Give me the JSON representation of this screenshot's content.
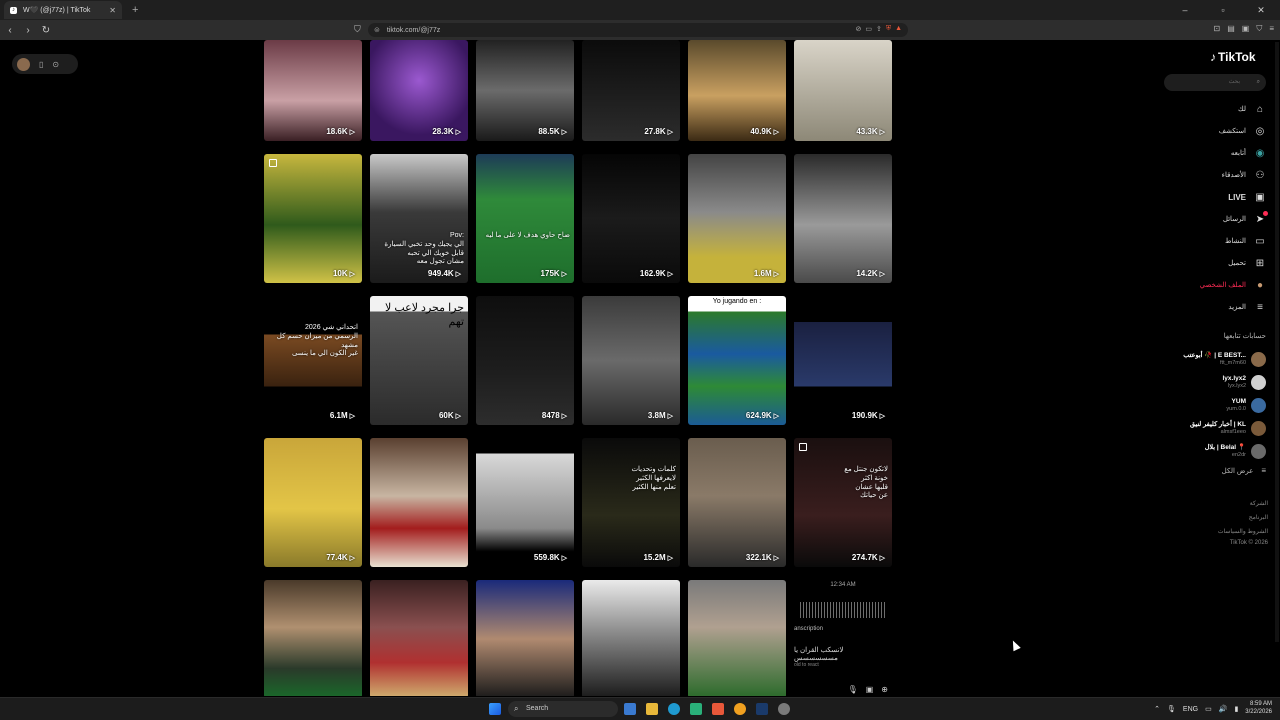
{
  "browser": {
    "tab_title": "W🖤 (@j77z) | TikTok",
    "new_tab": "+",
    "url": "tiktok.com/@j77z",
    "win_min": "–",
    "win_max": "▫",
    "win_close": "✕"
  },
  "grid": {
    "rows": [
      [
        {
          "views": "18.6K",
          "bg": "linear-gradient(180deg,#6b3b46,#c9a0a5 60%,#3a1f24)"
        },
        {
          "views": "28.3K",
          "bg": "radial-gradient(circle at 50% 40%,#9b59d0,#3a1760 70%)"
        },
        {
          "views": "88.5K",
          "bg": "linear-gradient(180deg,#222,#6b6b6b 50%,#1a1a1a)"
        },
        {
          "views": "27.8K",
          "bg": "linear-gradient(180deg,#0b0b0b,#2c2c2c)"
        },
        {
          "views": "40.9K",
          "bg": "linear-gradient(180deg,#5a4a2c,#c9a061 55%,#3b2a14)"
        },
        {
          "views": "43.3K",
          "bg": "linear-gradient(180deg,#d9d4c8,#8d8877)"
        }
      ],
      [
        {
          "views": "10K",
          "bg": "linear-gradient(180deg,#c7b73e,#2f5a1b 55%,#d0c247)"
        },
        {
          "views": "949.4K",
          "bg": "linear-gradient(180deg,#c9c9c9,#3a3a3a 45%,#1b1b1b)",
          "caption": "Pov:\nالي يجيك وحد تخبي السيارة\nقابل خويك الي تحبه\nمشان تجول معه"
        },
        {
          "views": "175K",
          "bg": "linear-gradient(180deg,#1d3b57,#2f8a3a 35%,#1e6e2c)",
          "caption": "ضاح حاوي هدف لا على ما ليه"
        },
        {
          "views": "162.9K",
          "bg": "linear-gradient(180deg,#050505,#1b1b1b 50%,#0a0a0a)"
        },
        {
          "views": "1.6M",
          "bg": "linear-gradient(180deg,#444,#8a8a8a 45%,#c5b23b 80%)"
        },
        {
          "views": "14.2K",
          "bg": "linear-gradient(180deg,#2a2a2a,#9a9a9a 55%,#4a4a4a)"
        }
      ],
      [
        {
          "views": "6.1M",
          "bg": "linear-gradient(180deg,#000 30%,#7a4a22 30%,#3a220f 70%,#000 70%)",
          "caption": "اتحداني شي 2026\nالرسمي من ميزان حسم كل مشهد\nغير الكون الي ما ينسى"
        },
        {
          "views": "60K",
          "bg": "linear-gradient(180deg,#f2f2f2 12%,#555 12%,#2b2b2b)",
          "caption": "جرا مجرد لاعب لا تهم"
        },
        {
          "views": "8478",
          "bg": "linear-gradient(180deg,#0e0e0e,#1e1e1e 60%,#2d2d2d)"
        },
        {
          "views": "3.8M",
          "bg": "linear-gradient(180deg,#3b3b3b,#6a6a6a 50%,#2a2a2a)"
        },
        {
          "views": "624.9K",
          "bg": "linear-gradient(180deg,#fff 12%,#2c7a2a 12%,#1a5aa0 45%,#2e8a36 70%,#1b5b95)",
          "caption": "Yo jugando en :"
        },
        {
          "views": "190.9K",
          "bg": "linear-gradient(180deg,#000 20%,#1a2040 20%,#2a3a6a 70%,#000 70%)"
        }
      ],
      [
        {
          "views": "77.4K",
          "bg": "linear-gradient(180deg,#c9a63a,#e3c547 55%,#8a7a2a)"
        },
        {
          "views": "",
          "bg": "linear-gradient(180deg,#5a4030,#c8b5a2 45%,#a31d1d 70%,#e8e0d0)"
        },
        {
          "views": "559.8K",
          "bg": "linear-gradient(180deg,#000 12%,#d9d9d9 12%,#8a8a8a 70%,#000 88%)"
        },
        {
          "views": "15.2M",
          "bg": "linear-gradient(180deg,#0a0a0a,#2a2a1a 60%,#0a0a0a)",
          "caption": "كلمات وتحديات\nلايعرفها الكثير\nتعلم منها الكثير"
        },
        {
          "views": "322.1K",
          "bg": "linear-gradient(180deg,#6a5d4e,#8a7a68 45%,#2a2a2a)"
        },
        {
          "views": "274.7K",
          "bg": "linear-gradient(180deg,#1a0f0f,#3a1e1e 60%,#0a0a0a)",
          "caption": "لاتكون جنتل مع\nخونة اكثر\nقلبها عشان\nعن حياتك"
        }
      ],
      [
        {
          "views": "",
          "bg": "linear-gradient(180deg,#4a3a2a,#b09070 40%,#2a3a2a 75%,#1a6a2a)"
        },
        {
          "views": "",
          "bg": "linear-gradient(180deg,#3a2020,#8a5050 40%,#b03030 70%,#d0b070)"
        },
        {
          "views": "",
          "bg": "linear-gradient(180deg,#1a2a7a,#b08a70 50%,#1a1a1a)"
        },
        {
          "views": "",
          "bg": "linear-gradient(180deg,#eaeaea,#8a8a8a 45%,#1a1a1a)"
        },
        {
          "views": "",
          "bg": "linear-gradient(180deg,#7a7a7a,#b0a090 40%,#2a6a2a)"
        },
        {
          "views": "",
          "bg": "#000",
          "caption": "12:34 AM"
        }
      ]
    ],
    "voice": {
      "transcription": "anscription",
      "quote": "لانسكب القران يا مسسسسسس",
      "react": "old to react"
    }
  },
  "sidebar": {
    "logo": "TikTok",
    "search_placeholder": "بحث",
    "items": [
      {
        "label": "لك",
        "icon": "⌂"
      },
      {
        "label": "استكشف",
        "icon": "◎"
      },
      {
        "label": "أتابعه",
        "icon": "◉"
      },
      {
        "label": "الأصدقاء",
        "icon": "⚇"
      },
      {
        "label": "LIVE",
        "icon": "▣"
      },
      {
        "label": "الرسائل",
        "icon": "➤"
      },
      {
        "label": "النشاط",
        "icon": "▭"
      },
      {
        "label": "تحميل",
        "icon": "⊞"
      },
      {
        "label": "الملف الشخصي",
        "icon": "●"
      },
      {
        "label": "المزيد",
        "icon": "≡"
      }
    ],
    "following_title": "حسابات تتابعها",
    "accounts": [
      {
        "name": "أبوعتب 🥀 | E BEST...",
        "handle": "ftt_m7m60",
        "color": "#8a6a4a"
      },
      {
        "name": "lyx.lyx2",
        "handle": "lyx.lyx2",
        "color": "#d0d0d0"
      },
      {
        "name": "YUM",
        "handle": "yum.0.0",
        "color": "#3a6aa0"
      },
      {
        "name": "أخبار كليفر لنيق | KL",
        "handle": "almsf1eeo",
        "color": "#7a5a3a"
      },
      {
        "name": "بلال | Belal 📍",
        "handle": "en2dr",
        "color": "#6a6a6a"
      }
    ],
    "show_more": "عرض الكل",
    "footer": [
      "الشركة",
      "البرنامج",
      "الشروط والسياسات",
      "TikTok © 2026"
    ]
  },
  "taskbar": {
    "search_label": "Search",
    "lang": "ENG",
    "time": "8:59 AM",
    "date": "3/22/2026"
  }
}
